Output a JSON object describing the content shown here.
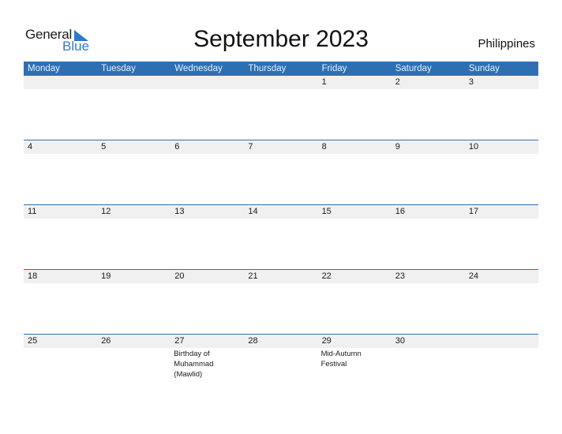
{
  "logo": {
    "line1": "General",
    "line2": "Blue",
    "accent": "#2e7ac9"
  },
  "title": "September 2023",
  "country": "Philippines",
  "colors": {
    "header_bg": "#2e6fb4",
    "date_bar_bg": "#f0f0f0"
  },
  "weekdays": [
    "Monday",
    "Tuesday",
    "Wednesday",
    "Thursday",
    "Friday",
    "Saturday",
    "Sunday"
  ],
  "weeks": [
    {
      "days": [
        "",
        "",
        "",
        "",
        "1",
        "2",
        "3"
      ],
      "events": [
        "",
        "",
        "",
        "",
        "",
        "",
        ""
      ]
    },
    {
      "days": [
        "4",
        "5",
        "6",
        "7",
        "8",
        "9",
        "10"
      ],
      "events": [
        "",
        "",
        "",
        "",
        "",
        "",
        ""
      ]
    },
    {
      "days": [
        "11",
        "12",
        "13",
        "14",
        "15",
        "16",
        "17"
      ],
      "events": [
        "",
        "",
        "",
        "",
        "",
        "",
        ""
      ]
    },
    {
      "days": [
        "18",
        "19",
        "20",
        "21",
        "22",
        "23",
        "24"
      ],
      "events": [
        "",
        "",
        "",
        "",
        "",
        "",
        ""
      ]
    },
    {
      "days": [
        "25",
        "26",
        "27",
        "28",
        "29",
        "30",
        ""
      ],
      "events": [
        "",
        "",
        "Birthday of Muhammad (Mawlid)",
        "",
        "Mid-Autumn Festival",
        "",
        ""
      ]
    }
  ]
}
